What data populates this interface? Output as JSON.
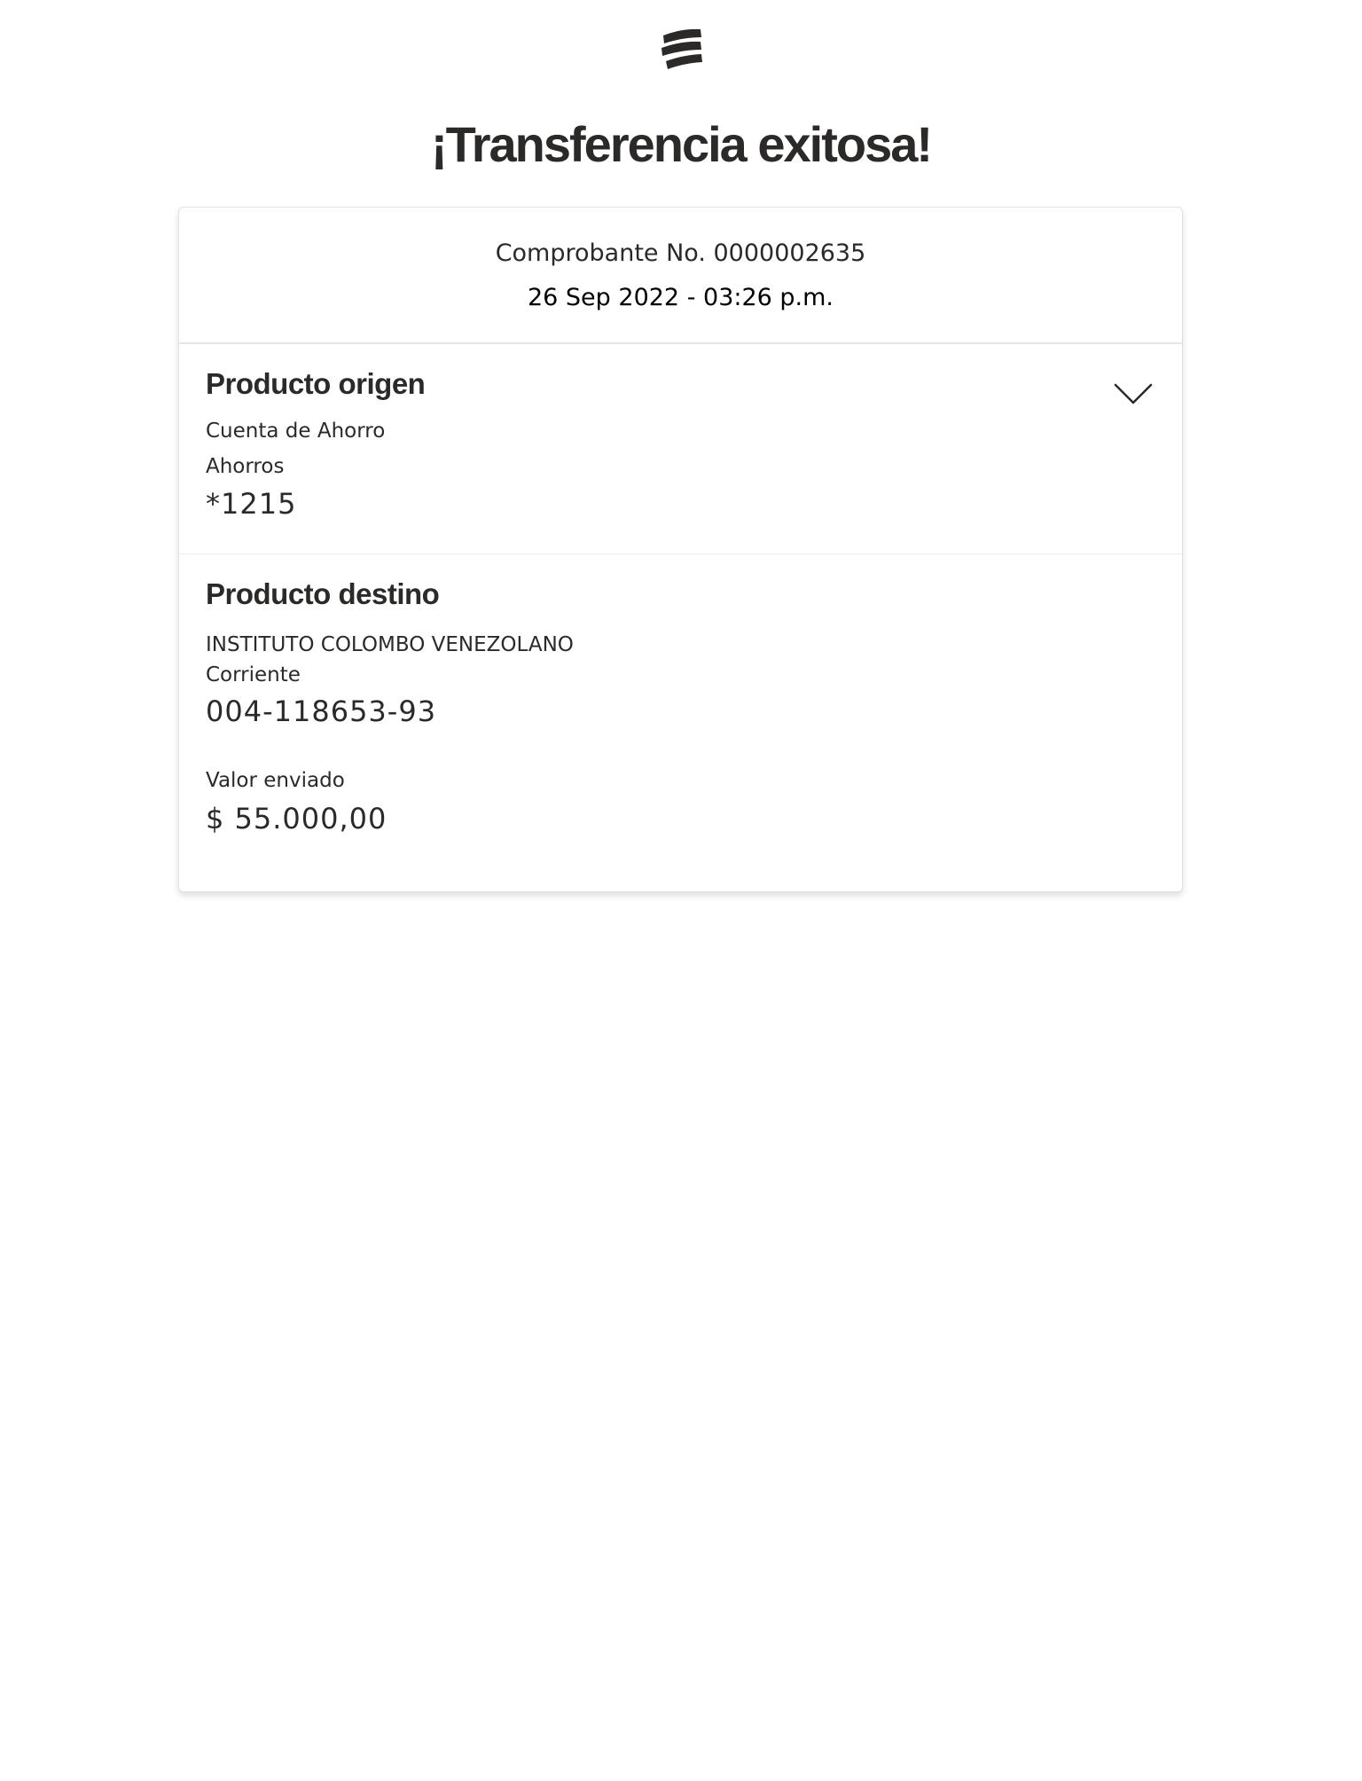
{
  "header": {
    "logo_icon": "bank-logo-icon",
    "title": "¡Transferencia exitosa!"
  },
  "receipt": {
    "number": "Comprobante No. 0000002635",
    "datetime": "26 Sep 2022 - 03:26 p.m."
  },
  "origin": {
    "title": "Producto origen",
    "toggle_icon": "chevron-down-icon",
    "product_name": "Cuenta de Ahorro",
    "account_type": "Ahorros",
    "account_number": "*1215"
  },
  "destination": {
    "title": "Producto destino",
    "holder_name": "INSTITUTO COLOMBO VENEZOLANO",
    "account_type": "Corriente",
    "account_number": "004-118653-93",
    "amount_label": "Valor enviado",
    "amount": "$ 55.000,00"
  },
  "colors": {
    "text": "#2c2a29",
    "card_border": "#e2e2e2",
    "divider": "#e6e6e6"
  }
}
